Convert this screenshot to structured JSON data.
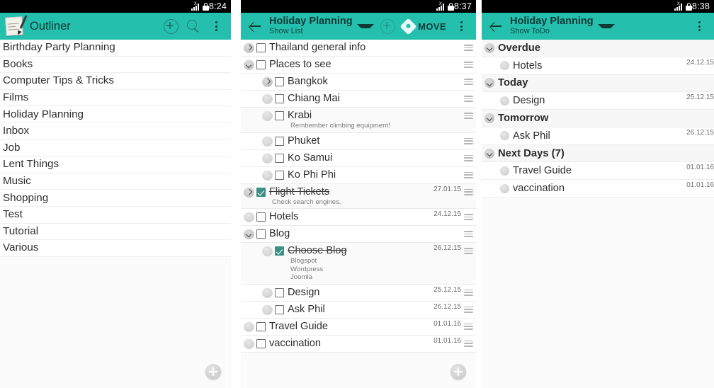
{
  "panel1": {
    "statusbar": {
      "time": "8:24",
      "signal_label": "X",
      "icons": [
        "signal-icon",
        "lock-icon"
      ]
    },
    "actionbar": {
      "app_icon": "notepad-pen-icon",
      "title": "Outliner",
      "actions": [
        {
          "name": "add-circle-icon",
          "label": ""
        },
        {
          "name": "search-icon",
          "label": ""
        },
        {
          "name": "overflow-menu-icon",
          "label": ""
        }
      ]
    },
    "items": [
      "Birthday Party Planning",
      "Books",
      "Computer Tips & Tricks",
      "Films",
      "Holiday Planning",
      "Inbox",
      "Job",
      "Lent Things",
      "Music",
      "Shopping",
      "Test",
      "Tutorial",
      "Various"
    ],
    "fab": "add-fab"
  },
  "panel2": {
    "statusbar": {
      "time": "8:37"
    },
    "actionbar": {
      "back": "back-arrow-icon",
      "title": "Holiday Planning",
      "subtitle": "Show List",
      "dropdown": "caret-down-icon",
      "add_label": "",
      "move_label": "MOVE",
      "overflow": "overflow-menu-icon"
    },
    "rows": [
      {
        "indent": 0,
        "twisty": "closed",
        "checked": false,
        "title": "Thailand general info",
        "date": "",
        "note": [],
        "handle": true
      },
      {
        "indent": 0,
        "twisty": "open",
        "checked": false,
        "title": "Places to see",
        "date": "",
        "note": [],
        "handle": true
      },
      {
        "indent": 1,
        "twisty": "closed",
        "checked": false,
        "title": "Bangkok",
        "date": "",
        "note": [],
        "handle": true
      },
      {
        "indent": 1,
        "twisty": "leaf",
        "checked": false,
        "title": "Chiang Mai",
        "date": "",
        "note": [],
        "handle": true
      },
      {
        "indent": 1,
        "twisty": "leaf",
        "checked": false,
        "title": "Krabi",
        "date": "",
        "note": [
          "Rembember climbing equipment!"
        ],
        "handle": true
      },
      {
        "indent": 1,
        "twisty": "leaf",
        "checked": false,
        "title": "Phuket",
        "date": "",
        "note": [],
        "handle": true
      },
      {
        "indent": 1,
        "twisty": "leaf",
        "checked": false,
        "title": "Ko Samui",
        "date": "",
        "note": [],
        "handle": true
      },
      {
        "indent": 1,
        "twisty": "leaf",
        "checked": false,
        "title": "Ko Phi Phi",
        "date": "",
        "note": [],
        "handle": true
      },
      {
        "indent": 0,
        "twisty": "closed",
        "checked": true,
        "title": "Flight Tickets",
        "date": "27.01.15",
        "note": [
          "Check search engines."
        ],
        "handle": true
      },
      {
        "indent": 0,
        "twisty": "leaf",
        "checked": false,
        "title": "Hotels",
        "date": "24.12.15",
        "note": [],
        "handle": true
      },
      {
        "indent": 0,
        "twisty": "open",
        "checked": false,
        "title": "Blog",
        "date": "",
        "note": [],
        "handle": true
      },
      {
        "indent": 1,
        "twisty": "leaf",
        "checked": true,
        "title": "Choose Blog",
        "date": "26.12.15",
        "note": [
          "Blogspot",
          "Wordpress",
          "Joomla"
        ],
        "handle": true
      },
      {
        "indent": 1,
        "twisty": "leaf",
        "checked": false,
        "title": "Design",
        "date": "25.12.15",
        "note": [],
        "handle": true
      },
      {
        "indent": 1,
        "twisty": "leaf",
        "checked": false,
        "title": "Ask Phil",
        "date": "26.12.15",
        "note": [],
        "handle": true
      },
      {
        "indent": 0,
        "twisty": "leaf",
        "checked": false,
        "title": "Travel Guide",
        "date": "01.01.16",
        "note": [],
        "handle": true
      },
      {
        "indent": 0,
        "twisty": "leaf",
        "checked": false,
        "title": "vaccination",
        "date": "01.01.16",
        "note": [],
        "handle": true
      }
    ],
    "fab": "add-fab"
  },
  "panel3": {
    "statusbar": {
      "time": "8:38"
    },
    "actionbar": {
      "back": "back-arrow-icon",
      "title": "Holiday Planning",
      "subtitle": "Show ToDo",
      "dropdown": "caret-down-icon",
      "overflow": "overflow-menu-icon"
    },
    "groups": [
      {
        "label": "Overdue",
        "items": [
          {
            "title": "Hotels",
            "date": "24.12.15"
          }
        ]
      },
      {
        "label": "Today",
        "items": [
          {
            "title": "Design",
            "date": "25.12.15"
          }
        ]
      },
      {
        "label": "Tomorrow",
        "items": [
          {
            "title": "Ask Phil",
            "date": "26.12.15"
          }
        ]
      },
      {
        "label": "Next Days (7)",
        "items": [
          {
            "title": "Travel Guide",
            "date": "01.01.16"
          },
          {
            "title": "vaccination",
            "date": "01.01.16"
          }
        ]
      }
    ]
  },
  "theme": {
    "accent": "#25bfae",
    "checkbox_checked": "#3d8f86",
    "statusbar_bg": "#000000",
    "text": "#2c2c2c"
  }
}
